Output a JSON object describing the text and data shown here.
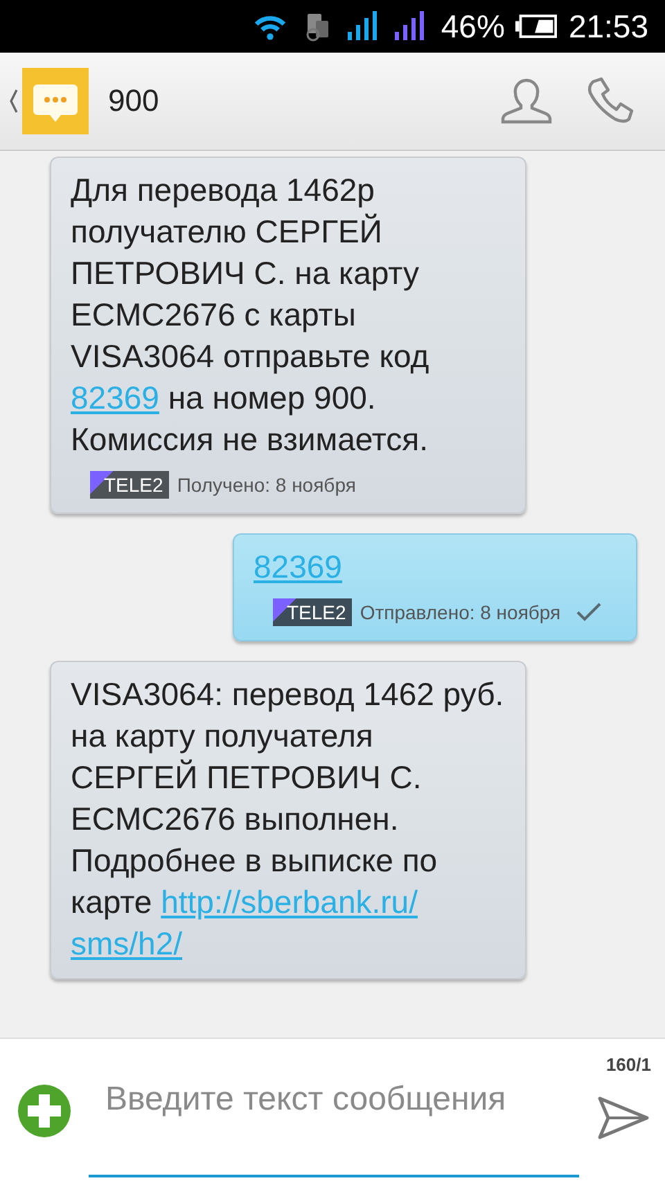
{
  "status_bar": {
    "battery": "46%",
    "time": "21:53"
  },
  "header": {
    "title": "900"
  },
  "messages": [
    {
      "kind": "in",
      "parts": [
        {
          "kind": "text",
          "text": "Для перевода 1462р получателю СЕРГЕЙ ПЕТРОВИЧ С. на карту ECMC2676 с карты VISA3064 отправьте код "
        },
        {
          "kind": "link",
          "text": "82369"
        },
        {
          "kind": "text",
          "text": " на номер 900. Комиссия не взимается."
        }
      ],
      "operator": "TELE2",
      "meta": "Получено: 8 ноября",
      "delivered": false
    },
    {
      "kind": "out",
      "parts": [
        {
          "kind": "link",
          "text": "82369"
        }
      ],
      "operator": "TELE2",
      "meta": "Отправлено: 8 ноября",
      "delivered": true
    },
    {
      "kind": "in",
      "parts": [
        {
          "kind": "text",
          "text": "VISA3064: перевод 1462 руб. на карту получателя СЕРГЕЙ ПЕТРОВИЧ С. ECMC2676 выполнен. Подробнее в выписке по карте "
        },
        {
          "kind": "link",
          "text": "http://sberbank.ru/"
        },
        {
          "kind": "link",
          "text": "sms/h2/"
        }
      ]
    }
  ],
  "composer": {
    "counter": "160/1",
    "placeholder": "Введите текст сообщения"
  }
}
